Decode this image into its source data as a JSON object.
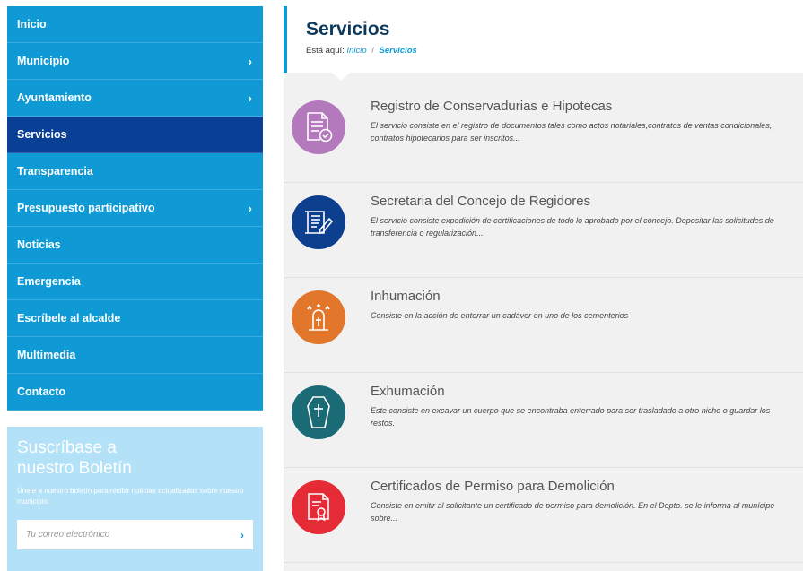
{
  "sidebar": {
    "items": [
      {
        "label": "Inicio",
        "chevron": ""
      },
      {
        "label": "Municipio",
        "chevron": "›"
      },
      {
        "label": "Ayuntamiento",
        "chevron": "›"
      },
      {
        "label": "Servicios",
        "chevron": ""
      },
      {
        "label": "Transparencia",
        "chevron": ""
      },
      {
        "label": "Presupuesto participativo",
        "chevron": "›"
      },
      {
        "label": "Noticias",
        "chevron": ""
      },
      {
        "label": "Emergencia",
        "chevron": ""
      },
      {
        "label": "Escríbele al alcalde",
        "chevron": ""
      },
      {
        "label": "Multimedia",
        "chevron": ""
      },
      {
        "label": "Contacto",
        "chevron": ""
      }
    ],
    "active_index": 3
  },
  "newsletter": {
    "title_line1": "Suscríbase a",
    "title_line2": "nuestro Boletín",
    "description": "Únete a nuestro boletín para recibir noticias actualizadas sobre nuestro municipio.",
    "email_placeholder": "Tu correo electrónico",
    "submit_glyph": "›"
  },
  "header": {
    "title": "Servicios",
    "breadcrumb_prefix": "Está aquí:",
    "breadcrumb": [
      "Inicio",
      "Servicios"
    ],
    "separator": "/"
  },
  "services": [
    {
      "title": "Registro de Conservadurias e Hipotecas",
      "description": "El servicio consiste en el registro de documentos tales como actos notariales,contratos de ventas condicionales, contratos hipotecarios para ser inscritos...",
      "icon": "document-check-icon",
      "color": "#b479bd"
    },
    {
      "title": "Secretaria del Concejo de Regidores",
      "description": "El servicio consiste expedición de certificaciones de todo lo aprobado por el concejo. Depositar las solicitudes  de transferencia o regularización...",
      "icon": "document-pen-icon",
      "color": "#0d3f8f"
    },
    {
      "title": "Inhumación",
      "description": "Consiste en la acción de enterrar un cadáver en uno de los cementerios",
      "icon": "tomb-icon",
      "color": "#e2762a"
    },
    {
      "title": "Exhumación",
      "description": "Este consiste en excavar un cuerpo que se encontraba enterrado para ser trasladado a otro nicho o guardar los restos.",
      "icon": "coffin-icon",
      "color": "#1a6b75"
    },
    {
      "title": "Certificados de Permiso para Demolición",
      "description": "Consiste en emitir al solicitante un certificado de permiso para demolición. En el Depto. se le  informa al munícipe sobre...",
      "icon": "certificate-icon",
      "color": "#e52b35"
    }
  ]
}
